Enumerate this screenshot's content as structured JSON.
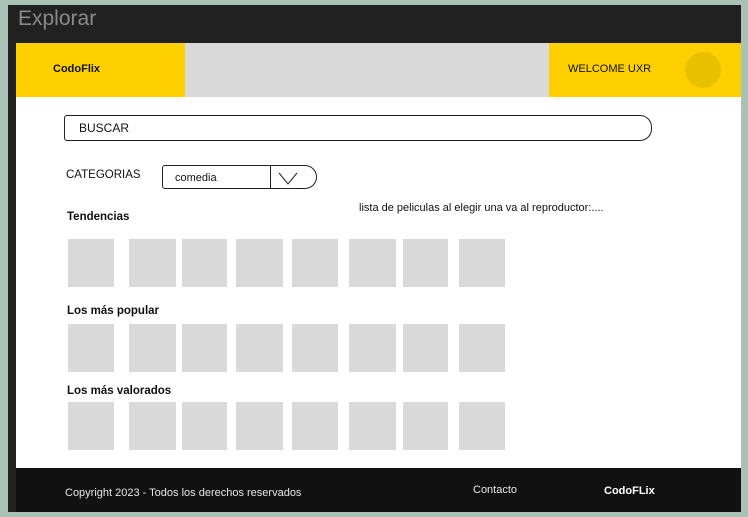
{
  "window": {
    "title": "Explorar"
  },
  "header": {
    "brand": "CodoFlix",
    "welcome": "WELCOME UXR"
  },
  "search": {
    "label": "BUSCAR"
  },
  "categories": {
    "label": "CATEGORIAS",
    "selected": "comedia"
  },
  "note": "lista de peliculas al elegir una va al reproductor:....",
  "sections": [
    {
      "title": "Tendencias",
      "tile_count": 8
    },
    {
      "title": "Los más popular",
      "tile_count": 8
    },
    {
      "title": "Los más valorados",
      "tile_count": 8
    }
  ],
  "footer": {
    "copyright": "Copyright 2023 - Todos los derechos reservados",
    "contact": "Contacto",
    "brand": "CodoFLix"
  },
  "colors": {
    "accent": "#ffd000",
    "placeholder": "#d9d9d9",
    "footer_bg": "#111111"
  }
}
